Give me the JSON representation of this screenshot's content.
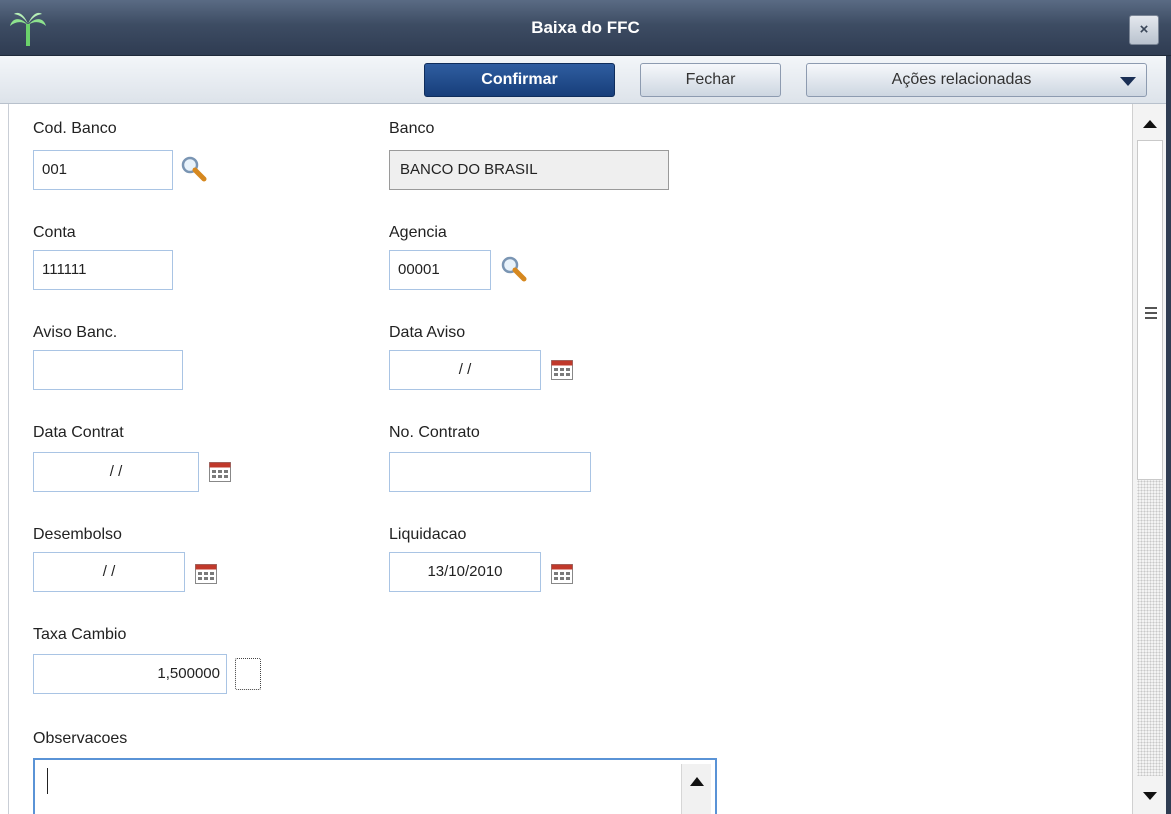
{
  "window": {
    "title": "Baixa do FFC",
    "close_glyph": "×"
  },
  "toolbar": {
    "confirm_label": "Confirmar",
    "close_label": "Fechar",
    "actions_label": "Ações relacionadas"
  },
  "form": {
    "cod_banco": {
      "label": "Cod. Banco",
      "value": "001"
    },
    "banco": {
      "label": "Banco",
      "value": "BANCO DO BRASIL"
    },
    "conta": {
      "label": "Conta",
      "value": "111111"
    },
    "agencia": {
      "label": "Agencia",
      "value": "00001"
    },
    "aviso_banc": {
      "label": "Aviso Banc.",
      "value": ""
    },
    "data_aviso": {
      "label": "Data Aviso",
      "value": "/ /"
    },
    "data_contrat": {
      "label": "Data Contrat",
      "value": "/ /"
    },
    "no_contrato": {
      "label": "No. Contrato",
      "value": ""
    },
    "desembolso": {
      "label": "Desembolso",
      "value": "/ /"
    },
    "liquidacao": {
      "label": "Liquidacao",
      "value": "13/10/2010"
    },
    "taxa_cambio": {
      "label": "Taxa Cambio",
      "value": "1,500000"
    },
    "observacoes": {
      "label": "Observacoes",
      "value": ""
    }
  },
  "icons": {
    "logo": "palm-tree-icon",
    "lookup": "magnifier-icon",
    "calendar": "calendar-icon",
    "dropdown": "chevron-down-icon"
  },
  "colors": {
    "titlebar": "#3d4c63",
    "confirm_button": "#173e7a",
    "input_border": "#a9c4e4",
    "focus_border": "#5a93d6"
  }
}
